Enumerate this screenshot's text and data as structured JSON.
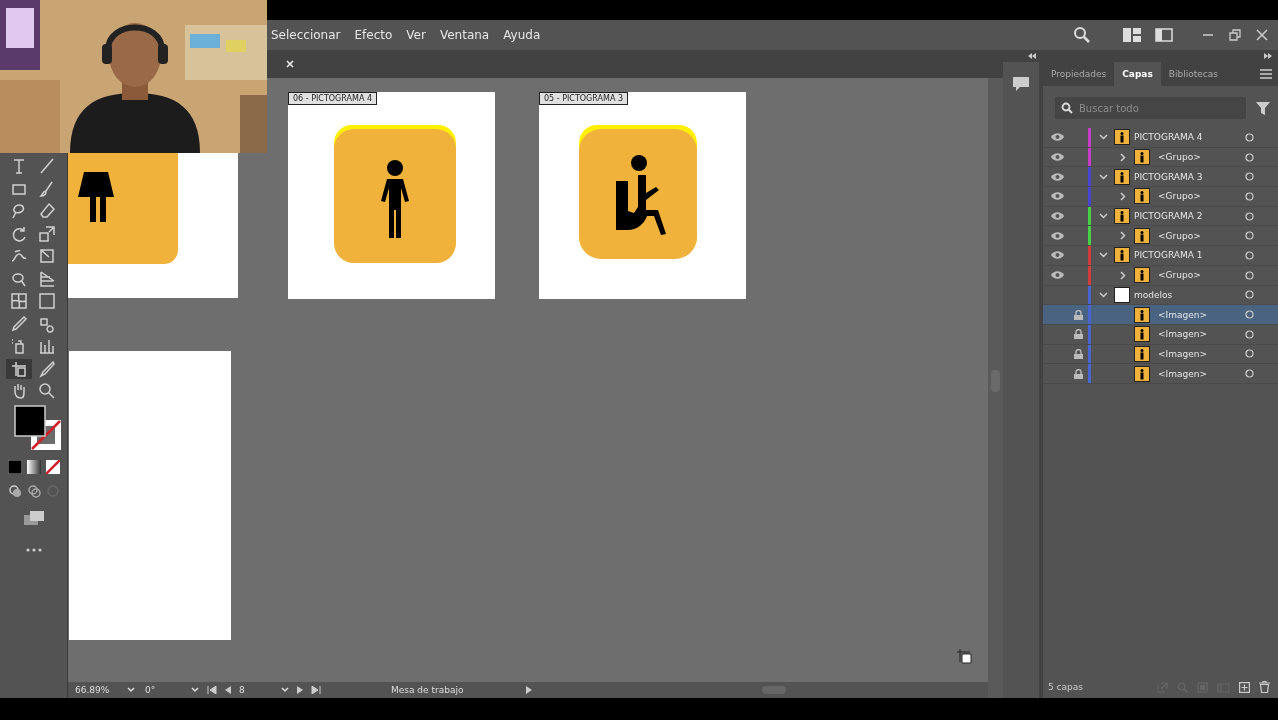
{
  "menu": [
    "Seleccionar",
    "Efecto",
    "Ver",
    "Ventana",
    "Ayuda"
  ],
  "artboards": [
    {
      "label": "06 - PICTOGRAMA 4",
      "kind": "standing"
    },
    {
      "label": "05 - PICTOGRAMA 3",
      "kind": "seated"
    }
  ],
  "status_bar": {
    "zoom": "66.89%",
    "rotation": "0°",
    "artboard": "8",
    "tool": "Mesa de trabajo"
  },
  "panel_tabs": [
    {
      "label": "Propiedades",
      "selected": false
    },
    {
      "label": "Capas",
      "selected": true
    },
    {
      "label": "Bibliotecas",
      "selected": false
    }
  ],
  "search": {
    "placeholder": "Buscar todo"
  },
  "layers": [
    {
      "name": "PICTOGRAMA 4",
      "color": "#c83cc8",
      "visible": true,
      "locked": false,
      "expanded": true,
      "selected": false,
      "kind": "pictogram",
      "children": [
        {
          "name": "<Grupo>",
          "visible": true,
          "locked": false,
          "expanded": false,
          "selected": false,
          "kind": "pictogram"
        }
      ]
    },
    {
      "name": "PICTOGRAMA 3",
      "color": "#4646d2",
      "visible": true,
      "locked": false,
      "expanded": true,
      "selected": false,
      "kind": "pictogram",
      "children": [
        {
          "name": "<Grupo>",
          "visible": true,
          "locked": false,
          "expanded": false,
          "selected": false,
          "kind": "pictogram"
        }
      ]
    },
    {
      "name": "PICTOGRAMA 2",
      "color": "#46d246",
      "visible": true,
      "locked": false,
      "expanded": true,
      "selected": false,
      "kind": "pictogram",
      "children": [
        {
          "name": "<Grupo>",
          "visible": true,
          "locked": false,
          "expanded": false,
          "selected": false,
          "kind": "pictogram"
        }
      ]
    },
    {
      "name": "PICTOGRAMA 1",
      "color": "#d23c3c",
      "visible": true,
      "locked": false,
      "expanded": true,
      "selected": false,
      "kind": "pictogram",
      "children": [
        {
          "name": "<Grupo>",
          "visible": true,
          "locked": false,
          "expanded": false,
          "selected": false,
          "kind": "pictogram"
        }
      ]
    },
    {
      "name": "modelos",
      "color": "#4a64d2",
      "visible": false,
      "locked": false,
      "expanded": true,
      "selected": false,
      "kind": "blank",
      "children": [
        {
          "name": "<Imagen>",
          "visible": false,
          "locked": true,
          "selected": true,
          "kind": "pictogram"
        },
        {
          "name": "<Imagen>",
          "visible": false,
          "locked": true,
          "selected": false,
          "kind": "pictogram"
        },
        {
          "name": "<Imagen>",
          "visible": false,
          "locked": true,
          "selected": false,
          "kind": "pictogram"
        },
        {
          "name": "<Imagen>",
          "visible": false,
          "locked": true,
          "selected": false,
          "kind": "pictogram"
        }
      ]
    }
  ],
  "layers_count": "5 capas"
}
